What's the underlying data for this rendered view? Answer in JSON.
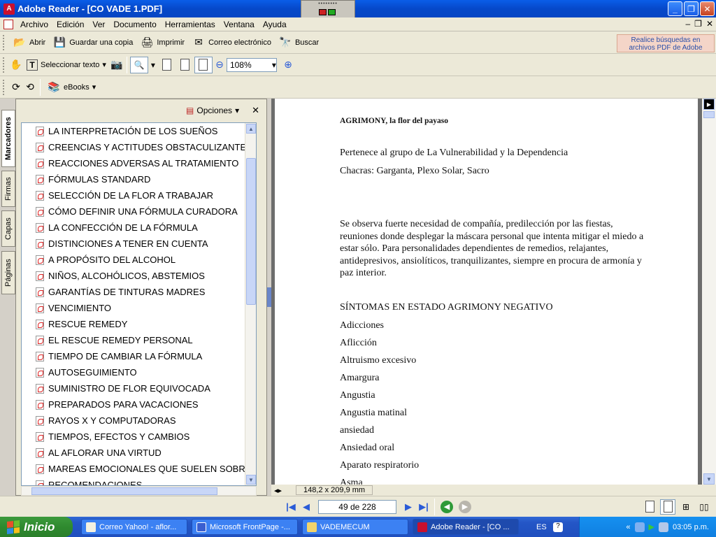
{
  "window": {
    "title": "Adobe Reader - [CO VADE 1.PDF]"
  },
  "menu": [
    "Archivo",
    "Edición",
    "Ver",
    "Documento",
    "Herramientas",
    "Ventana",
    "Ayuda"
  ],
  "toolbar1": {
    "open": "Abrir",
    "save_copy": "Guardar una copia",
    "print": "Imprimir",
    "email": "Correo electrónico",
    "search": "Buscar",
    "search_hint": "Realice búsquedas en archivos PDF de Adobe"
  },
  "toolbar2": {
    "select_text": "Seleccionar texto",
    "zoom": "108%"
  },
  "toolbar3": {
    "ebooks": "eBooks"
  },
  "side_tabs": [
    "Marcadores",
    "Firmas",
    "Capas",
    "Páginas"
  ],
  "bookmarks": {
    "options": "Opciones",
    "items": [
      "LA INTERPRETACIÓN DE LOS SUEÑOS",
      "CREENCIAS Y ACTITUDES OBSTACULIZANTES",
      "REACCIONES ADVERSAS AL TRATAMIENTO",
      "FÓRMULAS STANDARD",
      "SELECCIÓN DE LA FLOR A TRABAJAR",
      "CÓMO DEFINIR UNA FÓRMULA CURADORA",
      "LA CONFECCIÓN DE LA FÓRMULA",
      "DISTINCIONES A TENER EN CUENTA",
      "A PROPÓSITO DEL ALCOHOL",
      "NIÑOS, ALCOHÓLICOS, ABSTEMIOS",
      "GARANTÍAS DE TINTURAS MADRES",
      "VENCIMIENTO",
      "RESCUE REMEDY",
      "EL RESCUE REMEDY PERSONAL",
      "TIEMPO DE CAMBIAR LA FÓRMULA",
      "AUTOSEGUIMIENTO",
      "SUMINISTRO DE FLOR EQUIVOCADA",
      "PREPARADOS PARA VACACIONES",
      "RAYOS  X    Y  COMPUTADORAS",
      "TIEMPOS, EFECTOS Y CAMBIOS",
      "AL AFLORAR UNA VIRTUD",
      "MAREAS EMOCIONALES QUE SUELEN SOBRE",
      "RECOMENDACIONES"
    ]
  },
  "document": {
    "heading": "AGRIMONY, la flor del payaso",
    "group": "Pertenece al grupo de La Vulnerabilidad y la Dependencia",
    "chakras": "Chacras: Garganta, Plexo Solar, Sacro",
    "paragraph": " Se observa fuerte necesidad de compañía, predilección por las fiestas, reuniones donde desplegar la máscara personal que intenta mitigar el miedo a estar sólo.  Para personalidades dependientes de remedios, relajantes, antidepresivos, ansiolíticos, tranquilizantes, siempre en procura de armonía y paz interior.",
    "symptoms_title": "SÍNTOMAS EN ESTADO AGRIMONY NEGATIVO",
    "symptoms": [
      "Adicciones",
      "Aflicción",
      "Altruismo excesivo",
      "Amargura",
      "Angustia",
      "Angustia matinal",
      "ansiedad",
      "Ansiedad oral",
      "Aparato respiratorio",
      "Asma"
    ],
    "page_size": "148,2 x 209,9 mm"
  },
  "navigation": {
    "page_indicator": "49 de 228"
  },
  "taskbar": {
    "start": "Inicio",
    "items": [
      "Correo Yahoo! - aflor...",
      "Microsoft FrontPage -...",
      "VADEMECUM",
      "Adobe Reader - [CO ..."
    ],
    "language": "ES",
    "clock": "03:05 p.m."
  }
}
